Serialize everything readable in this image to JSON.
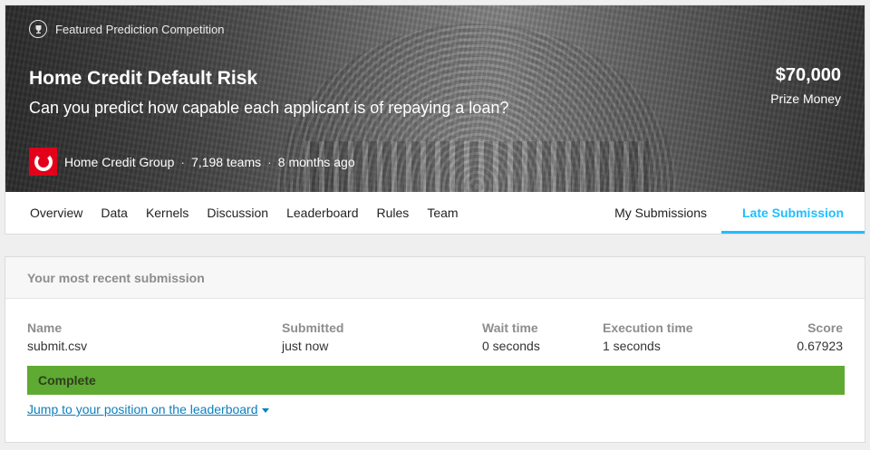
{
  "header": {
    "badge": "Featured Prediction Competition",
    "badge_icon": "trophy-icon",
    "title": "Home Credit Default Risk",
    "subtitle": "Can you predict how capable each applicant is of repaying a loan?",
    "prize_amount": "$70,000",
    "prize_label": "Prize Money",
    "host_name": "Home Credit Group",
    "teams": "7,198 teams",
    "age": "8 months ago",
    "separator": "·"
  },
  "nav": {
    "tabs": [
      "Overview",
      "Data",
      "Kernels",
      "Discussion",
      "Leaderboard",
      "Rules",
      "Team"
    ],
    "my_submissions": "My Submissions",
    "late_submission": "Late Submission",
    "active": "Late Submission",
    "accent_color": "#20beff"
  },
  "submission": {
    "section_title": "Your most recent submission",
    "headers": {
      "name": "Name",
      "submitted": "Submitted",
      "wait": "Wait time",
      "execution": "Execution time",
      "score": "Score"
    },
    "values": {
      "name": "submit.csv",
      "submitted": "just now",
      "wait": "0 seconds",
      "execution": "1 seconds",
      "score": "0.67923"
    },
    "status": "Complete",
    "status_color": "#5faa32",
    "jump_link": "Jump to your position on the leaderboard"
  }
}
